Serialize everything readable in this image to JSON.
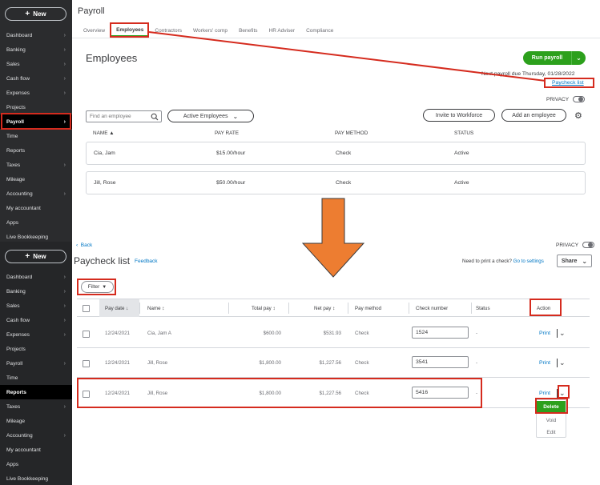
{
  "sidebar_top": {
    "new_label": "New",
    "items": [
      {
        "label": "Dashboard",
        "chev": true
      },
      {
        "label": "Banking",
        "chev": true
      },
      {
        "label": "Sales",
        "chev": true
      },
      {
        "label": "Cash flow",
        "chev": true
      },
      {
        "label": "Expenses",
        "chev": true
      },
      {
        "label": "Projects",
        "chev": false
      },
      {
        "label": "Payroll",
        "chev": true,
        "active": true
      },
      {
        "label": "Time",
        "chev": false
      },
      {
        "label": "Reports",
        "chev": false
      },
      {
        "label": "Taxes",
        "chev": true
      },
      {
        "label": "Mileage",
        "chev": false
      },
      {
        "label": "Accounting",
        "chev": true
      },
      {
        "label": "My accountant",
        "chev": false
      },
      {
        "label": "Apps",
        "chev": false
      },
      {
        "label": "Live Bookkeeping",
        "chev": false
      }
    ]
  },
  "sidebar_bottom": {
    "new_label": "New",
    "items": [
      {
        "label": "Dashboard",
        "chev": true
      },
      {
        "label": "Banking",
        "chev": true
      },
      {
        "label": "Sales",
        "chev": true
      },
      {
        "label": "Cash flow",
        "chev": true
      },
      {
        "label": "Expenses",
        "chev": true
      },
      {
        "label": "Projects",
        "chev": false
      },
      {
        "label": "Payroll",
        "chev": true
      },
      {
        "label": "Time",
        "chev": false
      },
      {
        "label": "Reports",
        "chev": false,
        "active": true
      },
      {
        "label": "Taxes",
        "chev": true
      },
      {
        "label": "Mileage",
        "chev": false
      },
      {
        "label": "Accounting",
        "chev": true
      },
      {
        "label": "My accountant",
        "chev": false
      },
      {
        "label": "Apps",
        "chev": false
      },
      {
        "label": "Live Bookkeeping",
        "chev": false
      }
    ]
  },
  "payroll": {
    "title": "Payroll",
    "tabs": [
      "Overview",
      "Employees",
      "Contractors",
      "Workers' comp",
      "Benefits",
      "HR Adviser",
      "Compliance"
    ],
    "active_tab": "Employees",
    "section_title": "Employees",
    "run_payroll_label": "Run payroll",
    "next_payroll": "Next payroll due Thursday, 01/28/2022",
    "paycheck_list_link": "Paycheck list",
    "privacy_label": "PRIVACY",
    "search_placeholder": "Find an employee",
    "filter_select": "Active Employees",
    "invite_label": "Invite to Workforce",
    "add_employee_label": "Add an employee",
    "columns": {
      "name": "NAME ▲",
      "pay_rate": "PAY RATE",
      "pay_method": "PAY METHOD",
      "status": "STATUS"
    },
    "employees": [
      {
        "name": "Cia, Jam",
        "pay_rate": "$15.00/hour",
        "pay_method": "Check",
        "status": "Active"
      },
      {
        "name": "Jill, Rose",
        "pay_rate": "$50.00/hour",
        "pay_method": "Check",
        "status": "Active"
      }
    ]
  },
  "paycheck_list": {
    "back_label": "Back",
    "title": "Paycheck list",
    "feedback_label": "Feedback",
    "need_print_text": "Need to print a check?",
    "go_settings_label": "Go to settings",
    "share_label": "Share",
    "privacy_label": "PRIVACY",
    "filter_label": "Filter",
    "columns": {
      "pay_date": "Pay date",
      "name": "Name",
      "total_pay": "Total pay",
      "net_pay": "Net pay",
      "pay_method": "Pay method",
      "check_number": "Check number",
      "status": "Status",
      "action": "Action"
    },
    "rows": [
      {
        "pay_date": "12/24/2021",
        "name": "Cia, Jam A",
        "total_pay": "$600.00",
        "net_pay": "$531.93",
        "pay_method": "Check",
        "check_number": "1524",
        "status": "-",
        "action": "Print"
      },
      {
        "pay_date": "12/24/2021",
        "name": "Jill, Rose",
        "total_pay": "$1,800.00",
        "net_pay": "$1,227.56",
        "pay_method": "Check",
        "check_number": "3541",
        "status": "-",
        "action": "Print"
      },
      {
        "pay_date": "12/24/2021",
        "name": "Jill, Rose",
        "total_pay": "$1,800.00",
        "net_pay": "$1,227.56",
        "pay_method": "Check",
        "check_number": "5416",
        "status": "-",
        "action": "Print"
      }
    ],
    "action_menu": [
      "Delete",
      "Void",
      "Edit"
    ]
  },
  "colors": {
    "brand_green": "#2ca01c",
    "link_blue": "#0077c5",
    "highlight_red": "#d52b1e",
    "arrow_orange": "#ed7d31",
    "sidebar_dark": "#2b2c2e"
  }
}
